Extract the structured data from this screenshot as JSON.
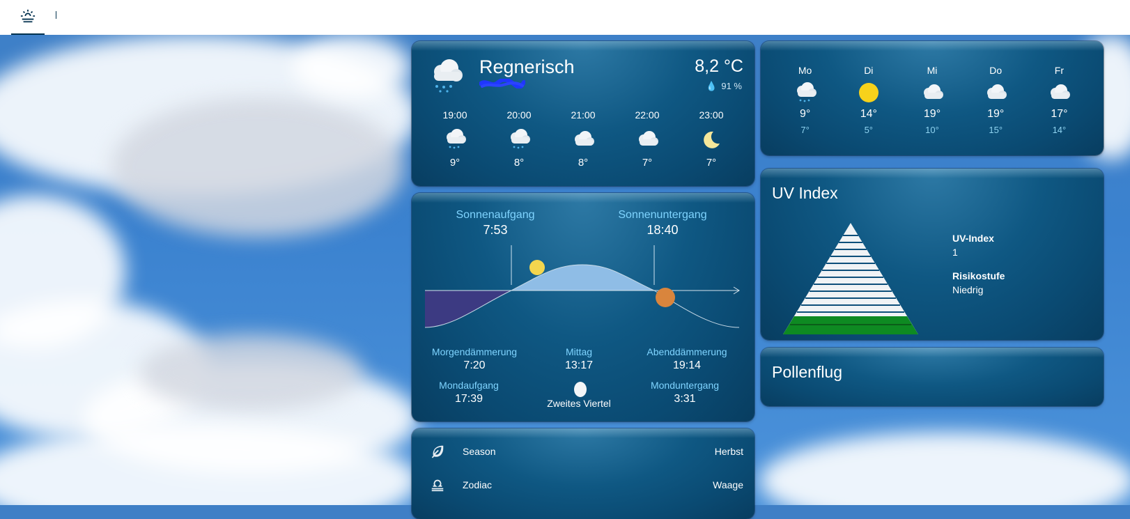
{
  "toolbar": {
    "tab_home_icon": "weather-sunset-icon",
    "tab_divider": "|"
  },
  "weather": {
    "condition": "Regnerisch",
    "temperature": "8,2 °C",
    "humidity": "91 %",
    "hourly": [
      {
        "time": "19:00",
        "icon": "rainy",
        "temp": "9°"
      },
      {
        "time": "20:00",
        "icon": "rainy",
        "temp": "8°"
      },
      {
        "time": "21:00",
        "icon": "cloudy",
        "temp": "8°"
      },
      {
        "time": "22:00",
        "icon": "cloudy",
        "temp": "7°"
      },
      {
        "time": "23:00",
        "icon": "clear-night",
        "temp": "7°"
      }
    ]
  },
  "forecast": {
    "days": [
      {
        "day": "Mo",
        "icon": "rainy",
        "high": "9°",
        "low": "7°"
      },
      {
        "day": "Di",
        "icon": "sunny",
        "high": "14°",
        "low": "5°"
      },
      {
        "day": "Mi",
        "icon": "cloudy",
        "high": "19°",
        "low": "10°"
      },
      {
        "day": "Do",
        "icon": "cloudy",
        "high": "19°",
        "low": "15°"
      },
      {
        "day": "Fr",
        "icon": "cloudy",
        "high": "17°",
        "low": "14°"
      }
    ],
    "low_color": "#8fd3f0"
  },
  "sun": {
    "sunrise_label": "Sonnenaufgang",
    "sunrise": "7:53",
    "sunset_label": "Sonnenuntergang",
    "sunset": "18:40",
    "dawn_label": "Morgendämmerung",
    "dawn": "7:20",
    "noon_label": "Mittag",
    "noon": "13:17",
    "dusk_label": "Abenddämmerung",
    "dusk": "19:14",
    "moonrise_label": "Mondaufgang",
    "moonrise": "17:39",
    "moon_phase": "Zweites Viertel",
    "moonset_label": "Monduntergang",
    "moonset": "3:31",
    "label_color": "#7fd4ff"
  },
  "uv": {
    "title": "UV Index",
    "index_label": "UV-Index",
    "index_value": "1",
    "risk_label": "Risikostufe",
    "risk_value": "Niedrig"
  },
  "pollen": {
    "title": "Pollenflug"
  },
  "season": {
    "rows": [
      {
        "key": "Season",
        "value": "Herbst",
        "icon": "leaf-icon"
      },
      {
        "key": "Zodiac",
        "value": "Waage",
        "icon": "zodiac-libra-icon"
      }
    ]
  }
}
